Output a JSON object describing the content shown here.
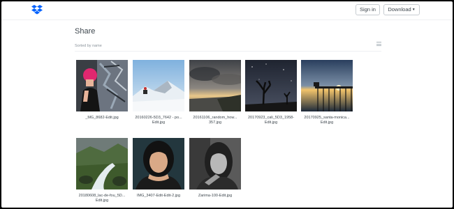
{
  "header": {
    "sign_in_label": "Sign in",
    "download_label": "Download",
    "brand_color": "#0061fe"
  },
  "main": {
    "title": "Share",
    "sort_label": "Sorted by name"
  },
  "files": [
    {
      "name": "_MG_8682-Edit.jpg"
    },
    {
      "name": "20160226-5D3_7642 - po... Edit.jpg"
    },
    {
      "name": "20161106_random_how... 357.jpg"
    },
    {
      "name": "20170923_cali_5D3_1958- Edit.jpg"
    },
    {
      "name": "20170925_santa-monica... Edit.jpg"
    },
    {
      "name": "20180608_lac-de-fou_5D... Edit.jpg"
    },
    {
      "name": "IMG_3407-Edit-Edit-2.jpg"
    },
    {
      "name": "Zarima-100-Edit.jpg"
    }
  ]
}
